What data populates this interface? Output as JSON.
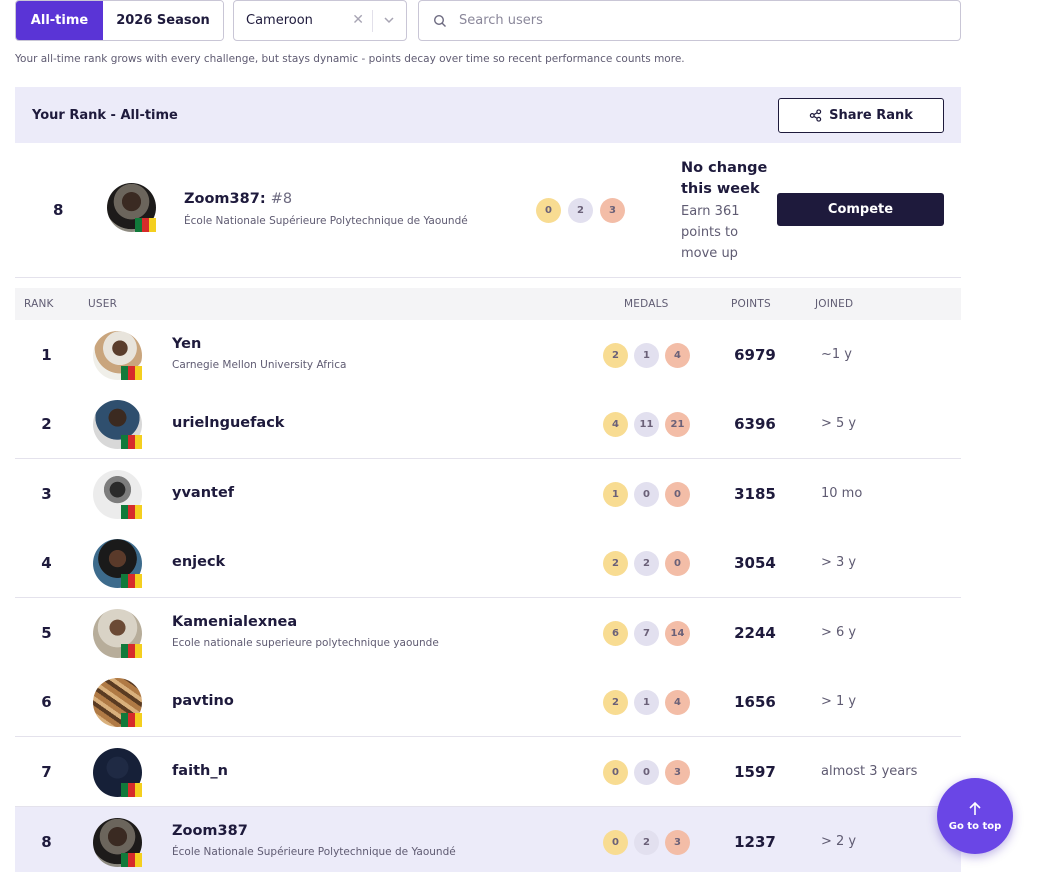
{
  "filters": {
    "tabs": [
      {
        "label": "All-time",
        "active": true
      },
      {
        "label": "2026 Season",
        "active": false
      }
    ],
    "country": "Cameroon",
    "search_placeholder": "Search users"
  },
  "hint": "Your all-time rank grows with every challenge, but stays dynamic - points decay over time so recent performance counts more.",
  "your_rank": {
    "title": "Your Rank - All-time",
    "share_label": "Share Rank",
    "rank": "8",
    "username": "Zoom387",
    "rank_tag": "#8",
    "institution": "École Nationale Supérieure Polytechnique de Yaoundé",
    "medals": [
      "0",
      "2",
      "3"
    ],
    "change": "No change this week",
    "earn": "Earn 361 points to move up",
    "compete_label": "Compete"
  },
  "table": {
    "headers": {
      "rank": "RANK",
      "user": "USER",
      "medals": "MEDALS",
      "points": "POINTS",
      "joined": "JOINED"
    },
    "rows": [
      {
        "rank": "1",
        "name": "Yen",
        "institution": "Carnegie Mellon University Africa",
        "medals": [
          "2",
          "1",
          "4"
        ],
        "points": "6979",
        "joined": "~1 y"
      },
      {
        "rank": "2",
        "name": "urielnguefack",
        "institution": "",
        "medals": [
          "4",
          "11",
          "21"
        ],
        "points": "6396",
        "joined": "> 5 y"
      },
      {
        "rank": "3",
        "name": "yvantef",
        "institution": "",
        "medals": [
          "1",
          "0",
          "0"
        ],
        "points": "3185",
        "joined": "10 mo"
      },
      {
        "rank": "4",
        "name": "enjeck",
        "institution": "",
        "medals": [
          "2",
          "2",
          "0"
        ],
        "points": "3054",
        "joined": "> 3 y"
      },
      {
        "rank": "5",
        "name": "Kamenialexnea",
        "institution": "Ecole nationale superieure polytechnique yaounde",
        "medals": [
          "6",
          "7",
          "14"
        ],
        "points": "2244",
        "joined": "> 6 y"
      },
      {
        "rank": "6",
        "name": "pavtino",
        "institution": "",
        "medals": [
          "2",
          "1",
          "4"
        ],
        "points": "1656",
        "joined": "> 1 y"
      },
      {
        "rank": "7",
        "name": "faith_n",
        "institution": "",
        "medals": [
          "0",
          "0",
          "3"
        ],
        "points": "1597",
        "joined": "almost 3 years"
      },
      {
        "rank": "8",
        "name": "Zoom387",
        "institution": "École Nationale Supérieure Polytechnique de Yaoundé",
        "medals": [
          "0",
          "2",
          "3"
        ],
        "points": "1237",
        "joined": "> 2 y"
      }
    ]
  },
  "go_to_top": "Go to top",
  "colors": {
    "accent": "#5a34d6",
    "dark": "#1e1a3c",
    "gold": "#f8dc92",
    "silver": "#e2e0ef",
    "bronze": "#f3bda7"
  }
}
